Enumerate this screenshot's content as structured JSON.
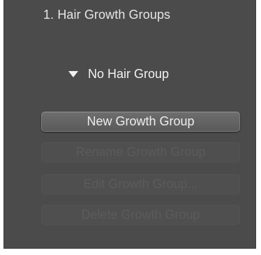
{
  "panel": {
    "title": "1. Hair Growth Groups"
  },
  "group_selector": {
    "selected": "No Hair Group",
    "icon": "triangle-down-icon"
  },
  "buttons": {
    "new_group": "New Growth Group",
    "rename_group": "Rename Growth Group",
    "edit_group": "Edit Growth Group...",
    "delete_group": "Delete Growth Group"
  },
  "colors": {
    "panel_background": "#4b4b4b",
    "text": "#e6e6e6",
    "disabled_text": "#5b5b5b"
  }
}
